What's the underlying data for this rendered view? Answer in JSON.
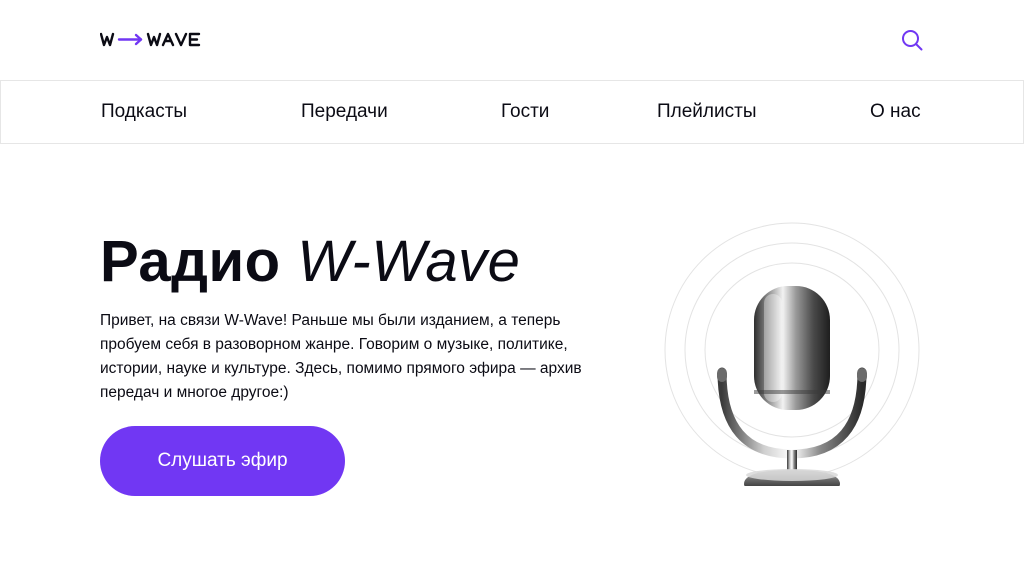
{
  "header": {
    "logo_text": "W→WAVE",
    "search_icon": "search-icon",
    "accent_color": "#7137f3"
  },
  "nav": {
    "items": [
      {
        "label": "Подкасты"
      },
      {
        "label": "Передачи"
      },
      {
        "label": "Гости"
      },
      {
        "label": "Плейлисты"
      },
      {
        "label": "О нас"
      }
    ]
  },
  "hero": {
    "title_bold": "Радио",
    "title_light": "W-Wave",
    "description": "Привет, на связи W-Wave! Раньше мы были изданием, а теперь пробуем себя в разоворном жанре. Говорим о музыке, политике, истории, науке и культуре. Здесь, помимо прямого эфира — архив передач и многое другое:)",
    "cta_label": "Слушать эфир",
    "illustration": "microphone-icon"
  }
}
